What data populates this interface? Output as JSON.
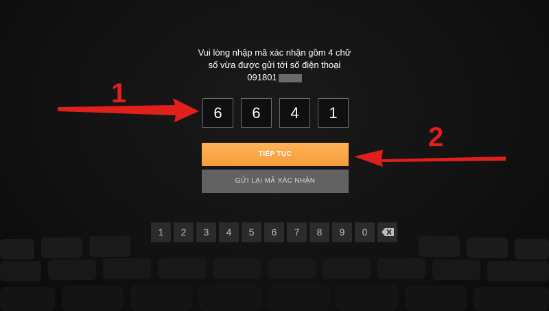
{
  "prompt": {
    "line1": "Vui lòng nhập mã xác nhận gồm 4 chữ",
    "line2": "số vừa được gửi tới số điện thoại",
    "phone_visible": "091801"
  },
  "code_digits": [
    "6",
    "6",
    "4",
    "1"
  ],
  "buttons": {
    "continue_label": "TIẾP TỤC",
    "resend_label": "GỬI LẠI MÃ XÁC NHẬN"
  },
  "keypad": {
    "keys": [
      "1",
      "2",
      "3",
      "4",
      "5",
      "6",
      "7",
      "8",
      "9",
      "0"
    ],
    "backspace_icon": "backspace-icon"
  },
  "annotations": {
    "marker_1": "1",
    "marker_2": "2",
    "arrow_color": "#e0201b"
  },
  "colors": {
    "primary_button": "#f59d3a",
    "secondary_button": "#626262",
    "background": "#121212"
  }
}
